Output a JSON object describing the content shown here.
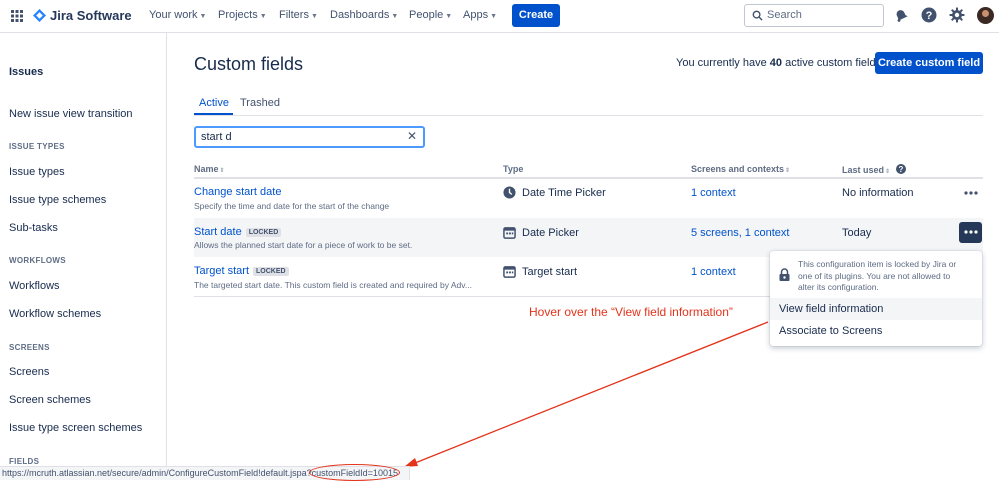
{
  "topbar": {
    "app_name": "Jira Software",
    "nav": [
      {
        "label": "Your work"
      },
      {
        "label": "Projects"
      },
      {
        "label": "Filters"
      },
      {
        "label": "Dashboards"
      },
      {
        "label": "People"
      },
      {
        "label": "Apps"
      }
    ],
    "create_label": "Create",
    "search_placeholder": "Search",
    "icons": [
      "app-switcher-icon",
      "notifications-icon",
      "help-icon",
      "settings-icon",
      "avatar"
    ]
  },
  "sidebar": {
    "heading": "Issues",
    "top_item": "New issue view transition",
    "sections": [
      {
        "title": "ISSUE TYPES",
        "items": [
          "Issue types",
          "Issue type schemes",
          "Sub-tasks"
        ]
      },
      {
        "title": "WORKFLOWS",
        "items": [
          "Workflows",
          "Workflow schemes"
        ]
      },
      {
        "title": "SCREENS",
        "items": [
          "Screens",
          "Screen schemes",
          "Issue type screen schemes"
        ]
      },
      {
        "title": "FIELDS",
        "items": []
      }
    ]
  },
  "main": {
    "title": "Custom fields",
    "count_prefix": "You currently have",
    "count": "40",
    "count_suffix": "active custom fields",
    "create_button": "Create custom field",
    "tabs": [
      {
        "label": "Active",
        "active": true
      },
      {
        "label": "Trashed",
        "active": false
      }
    ],
    "filter_value": "start d",
    "columns": [
      "Name",
      "Type",
      "Screens and contexts",
      "Last used"
    ],
    "rows": [
      {
        "name": "Change start date",
        "locked": false,
        "description": "Specify the time and date for the start of the change",
        "type": "Date Time Picker",
        "type_icon": "clock-icon",
        "contexts": "1 context",
        "last_used": "No information"
      },
      {
        "name": "Start date",
        "locked": true,
        "locked_label": "LOCKED",
        "description": "Allows the planned start date for a piece of work to be set.",
        "type": "Date Picker",
        "type_icon": "calendar-icon",
        "contexts": "5 screens, 1 context",
        "last_used": "Today"
      },
      {
        "name": "Target start",
        "locked": true,
        "locked_label": "LOCKED",
        "description": "The targeted start date. This custom field is created and required by Adv...",
        "type": "Target start",
        "type_icon": "calendar-icon",
        "contexts": "1 context",
        "last_used": ""
      }
    ]
  },
  "dropdown": {
    "notice": [
      "This configuration item is locked by Jira or",
      "one of its plugins. You are not allowed to",
      "alter its configuration."
    ],
    "items": [
      "View field information",
      "Associate to Screens"
    ]
  },
  "annotation": {
    "text": "Hover over the “View field information”",
    "color": "#e3331b"
  },
  "statusbar": {
    "url": "https://mcruth.atlassian.net/secure/admin/ConfigureCustomField!default.jspa?",
    "highlight": "customFieldId=10015"
  },
  "colors": {
    "brand": "#0052cc",
    "text": "#172b4d",
    "annotation": "#e3331b"
  }
}
